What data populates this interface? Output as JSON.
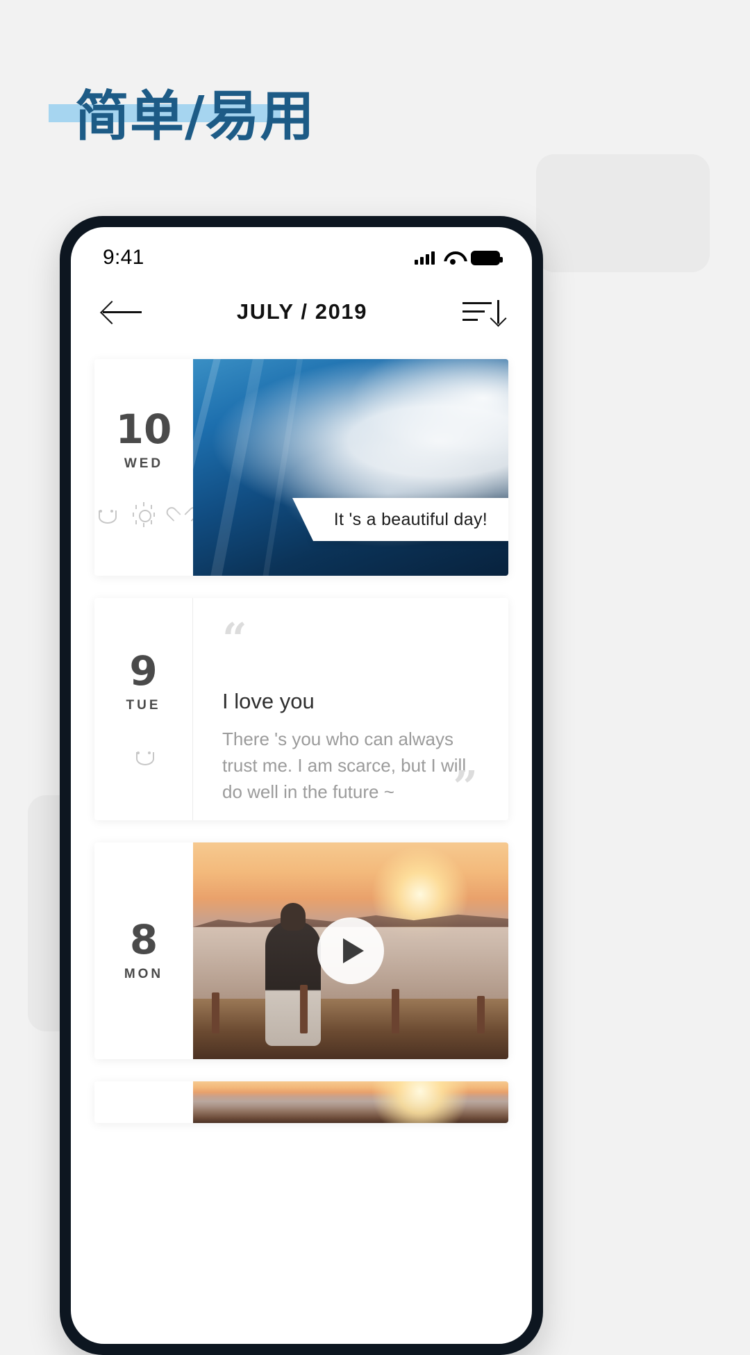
{
  "page": {
    "headline": "简单/易用",
    "headline_color": "#1d5b86",
    "underline_color": "#a6d5f0",
    "background_color": "#f2f2f2"
  },
  "phone": {
    "status_bar": {
      "time": "9:41",
      "icons": [
        "signal-icon",
        "wifi-icon",
        "battery-icon"
      ]
    },
    "nav_bar": {
      "back_icon": "back-arrow-icon",
      "title": "JULY / 2019",
      "sort_icon": "sort-descending-icon"
    }
  },
  "feed": {
    "entries": [
      {
        "day": "10",
        "weekday": "WED",
        "moods": [
          "smiley-icon",
          "sun-icon",
          "heart-icon"
        ],
        "type": "photo",
        "caption": "It 's a beautiful day!"
      },
      {
        "day": "9",
        "weekday": "TUE",
        "moods": [
          "smiley-icon"
        ],
        "type": "quote",
        "quote_open": "“",
        "quote_close": "”",
        "title": "I love you",
        "body": "There 's you who can always trust me. I am scarce, but I will do well in the future ~"
      },
      {
        "day": "8",
        "weekday": "MON",
        "moods": [],
        "type": "video",
        "play_icon": "play-icon"
      }
    ]
  }
}
